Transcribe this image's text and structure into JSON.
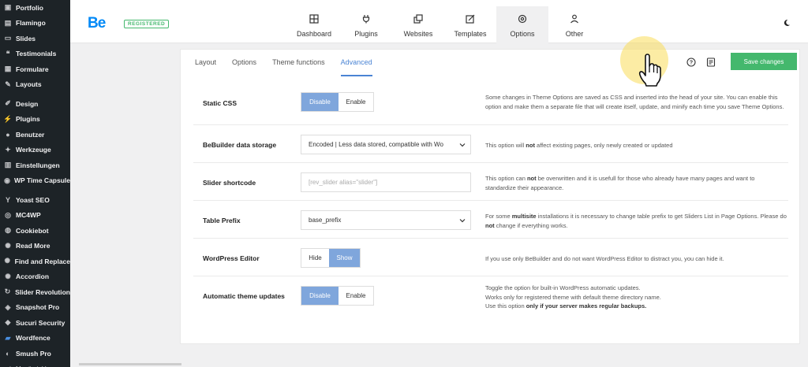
{
  "sidebar": {
    "items": [
      {
        "label": "Portfolio",
        "icon": "portfolio-icon"
      },
      {
        "label": "Flamingo",
        "icon": "flamingo-icon"
      },
      {
        "label": "Slides",
        "icon": "slides-icon"
      },
      {
        "label": "Testimonials",
        "icon": "quote-icon"
      },
      {
        "label": "Formulare",
        "icon": "form-icon"
      },
      {
        "label": "Layouts",
        "icon": "layouts-icon"
      },
      {
        "label": "Design",
        "icon": "design-icon"
      },
      {
        "label": "Plugins",
        "icon": "plugins-icon"
      },
      {
        "label": "Benutzer",
        "icon": "users-icon"
      },
      {
        "label": "Werkzeuge",
        "icon": "tools-icon"
      },
      {
        "label": "Einstellungen",
        "icon": "settings-icon"
      },
      {
        "label": "WP Time Capsule",
        "icon": "capsule-icon"
      },
      {
        "label": "Yoast SEO",
        "icon": "yoast-icon"
      },
      {
        "label": "MC4WP",
        "icon": "mc4wp-icon"
      },
      {
        "label": "Cookiebot",
        "icon": "cookiebot-icon"
      },
      {
        "label": "Read More",
        "icon": "gear-icon"
      },
      {
        "label": "Find and Replace",
        "icon": "gear-icon"
      },
      {
        "label": "Accordion",
        "icon": "gear-icon"
      },
      {
        "label": "Slider Revolution",
        "icon": "slider-icon"
      },
      {
        "label": "Snapshot Pro",
        "icon": "snapshot-icon"
      },
      {
        "label": "Sucuri Security",
        "icon": "sucuri-icon"
      },
      {
        "label": "Wordfence",
        "icon": "wordfence-icon"
      },
      {
        "label": "Smush Pro",
        "icon": "smush-icon"
      },
      {
        "label": "Menü einklappen",
        "icon": "collapse-icon"
      }
    ]
  },
  "header": {
    "logo": "Be",
    "badge": "REGISTERED",
    "nav": [
      {
        "label": "Dashboard",
        "icon": "dashboard-icon"
      },
      {
        "label": "Plugins",
        "icon": "plug-icon"
      },
      {
        "label": "Websites",
        "icon": "websites-icon"
      },
      {
        "label": "Templates",
        "icon": "templates-icon"
      },
      {
        "label": "Options",
        "icon": "options-gear-icon"
      },
      {
        "label": "Other",
        "icon": "other-icon"
      }
    ],
    "active_nav": "Options"
  },
  "tabs": [
    "Layout",
    "Options",
    "Theme functions",
    "Advanced"
  ],
  "active_tab": "Advanced",
  "save_label": "Save changes",
  "options": {
    "static_css": {
      "label": "Static CSS",
      "buttons": [
        "Disable",
        "Enable"
      ],
      "selected": "Disable",
      "desc": "Some changes in Theme Options are saved as CSS and inserted into the head of your site. You can enable this option and make them a separate file that will create itself, update, and minify each time you save Theme Options."
    },
    "data_storage": {
      "label": "BeBuilder data storage",
      "value": "Encoded | Less data stored, compatible with Wo",
      "desc_pre": "This option will ",
      "desc_bold": "not",
      "desc_post": " affect existing pages, only newly created or updated"
    },
    "slider_shortcode": {
      "label": "Slider shortcode",
      "placeholder": "[rev_slider alias=\"slider\"]",
      "desc_pre": "This option can ",
      "desc_bold": "not",
      "desc_post": " be overwritten and it is usefull for those who already have many pages and want to standardize their appearance."
    },
    "table_prefix": {
      "label": "Table Prefix",
      "value": "base_prefix",
      "desc_pre": "For some ",
      "desc_bold": "multisite",
      "desc_mid": " installations it is necessary to change table prefix to get Sliders List in Page Options. Please do ",
      "desc_bold2": "not",
      "desc_post": " change if everything works."
    },
    "wp_editor": {
      "label": "WordPress Editor",
      "buttons": [
        "Hide",
        "Show"
      ],
      "selected": "Show",
      "desc": "If you use only BeBuilder and do not want WordPress Editor to distract you, you can hide it."
    },
    "auto_updates": {
      "label": "Automatic theme updates",
      "buttons": [
        "Disable",
        "Enable"
      ],
      "selected": "Disable",
      "desc_line1": "Toggle the option for built-in WordPress automatic updates.",
      "desc_line2": "Works only for registered theme with default theme directory name.",
      "desc_line3_pre": "Use this option ",
      "desc_line3_bold": "only if your server makes regular backups."
    }
  },
  "colors": {
    "accent": "#7fa6dc",
    "save": "#44b86d",
    "logo": "#0089f7",
    "sidebar_bg": "#1d2327"
  }
}
